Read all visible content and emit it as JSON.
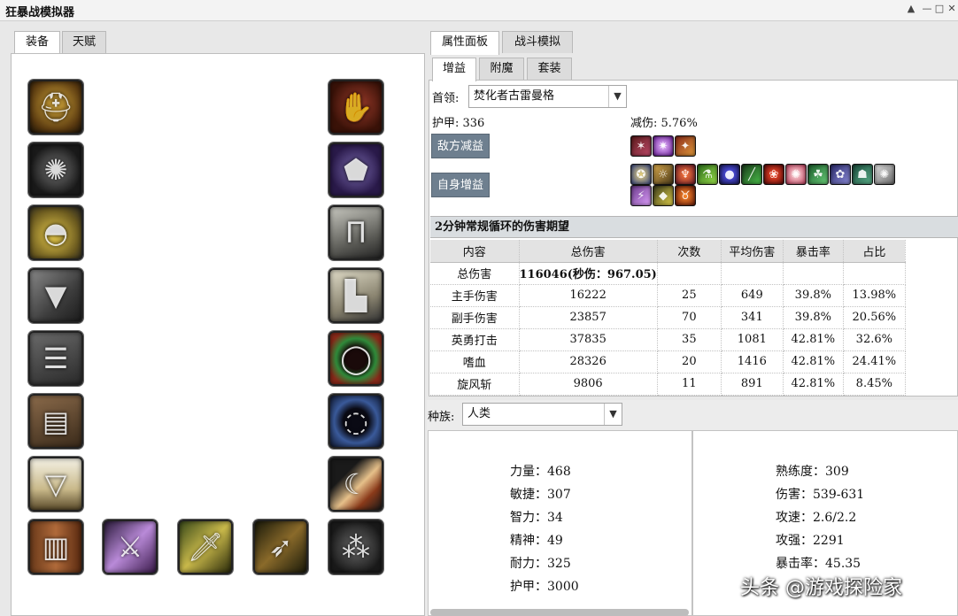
{
  "window": {
    "title": "狂暴战模拟器",
    "controls": [
      "▲",
      "—",
      "□",
      "✕"
    ]
  },
  "left_tabs": [
    "装备",
    "天赋"
  ],
  "right_tabs": [
    "属性面板",
    "战斗模拟"
  ],
  "sub_tabs": [
    "增益",
    "附魔",
    "套装"
  ],
  "boss": {
    "label": "首领:",
    "value": "焚化者古雷曼格"
  },
  "armor_text": "护甲: 336",
  "reduction_text": "减伤: 5.76%",
  "buttons": {
    "enemy_debuff": "敌方减益",
    "self_buff": "自身增益"
  },
  "section_title": "2分钟常规循环的伤害期望",
  "table": {
    "headers": [
      "内容",
      "总伤害",
      "次数",
      "平均伤害",
      "暴击率",
      "占比"
    ],
    "total": {
      "label": "总伤害",
      "value": "116046(秒伤：967.05)"
    },
    "rows": [
      [
        "主手伤害",
        "16222",
        "25",
        "649",
        "39.8%",
        "13.98%"
      ],
      [
        "副手伤害",
        "23857",
        "70",
        "341",
        "39.8%",
        "20.56%"
      ],
      [
        "英勇打击",
        "37835",
        "35",
        "1081",
        "42.81%",
        "32.6%"
      ],
      [
        "嗜血",
        "28326",
        "20",
        "1416",
        "42.81%",
        "24.41%"
      ],
      [
        "旋风斩",
        "9806",
        "11",
        "891",
        "42.81%",
        "8.45%"
      ]
    ]
  },
  "race": {
    "label": "种族:",
    "value": "人类"
  },
  "stats_left": [
    "力量：468",
    "敏捷：307",
    "智力：34",
    "精神：49",
    "耐力：325",
    "护甲：3000"
  ],
  "stats_right": [
    "熟练度：309",
    "伤害：539-631",
    "攻速：2.6/2.2",
    "攻强：2291",
    "暴击率：45.35"
  ],
  "watermark": "头条 @游戏探险家",
  "colors": {
    "button": "#6e7f8f",
    "section_header": "#d9dde0"
  },
  "equipment_icons": [
    "helmet-icon",
    "neck-icon",
    "shoulder-icon",
    "cloak-icon",
    "chest-icon",
    "shirt-icon",
    "tabard-icon",
    "wrist-icon",
    "gloves-icon",
    "belt-icon",
    "legs-icon",
    "boots-icon",
    "ring-icon",
    "ring-icon",
    "trinket-icon",
    "main-hand-icon",
    "off-hand-icon",
    "ranged-icon",
    "ammo-icon"
  ],
  "debuff_icons": [
    "sunder-armor-icon",
    "curse-icon",
    "faerie-fire-icon"
  ],
  "buff_icons": [
    "blessing-icon",
    "aura-icon",
    "totem-icon",
    "potion-icon",
    "flask-icon",
    "elixir-icon",
    "food-icon",
    "scroll-icon",
    "juju-icon",
    "songflower-icon",
    "zandalar-icon",
    "rallying-cry-icon",
    "shout-icon",
    "stone-icon",
    "windfury-icon"
  ]
}
